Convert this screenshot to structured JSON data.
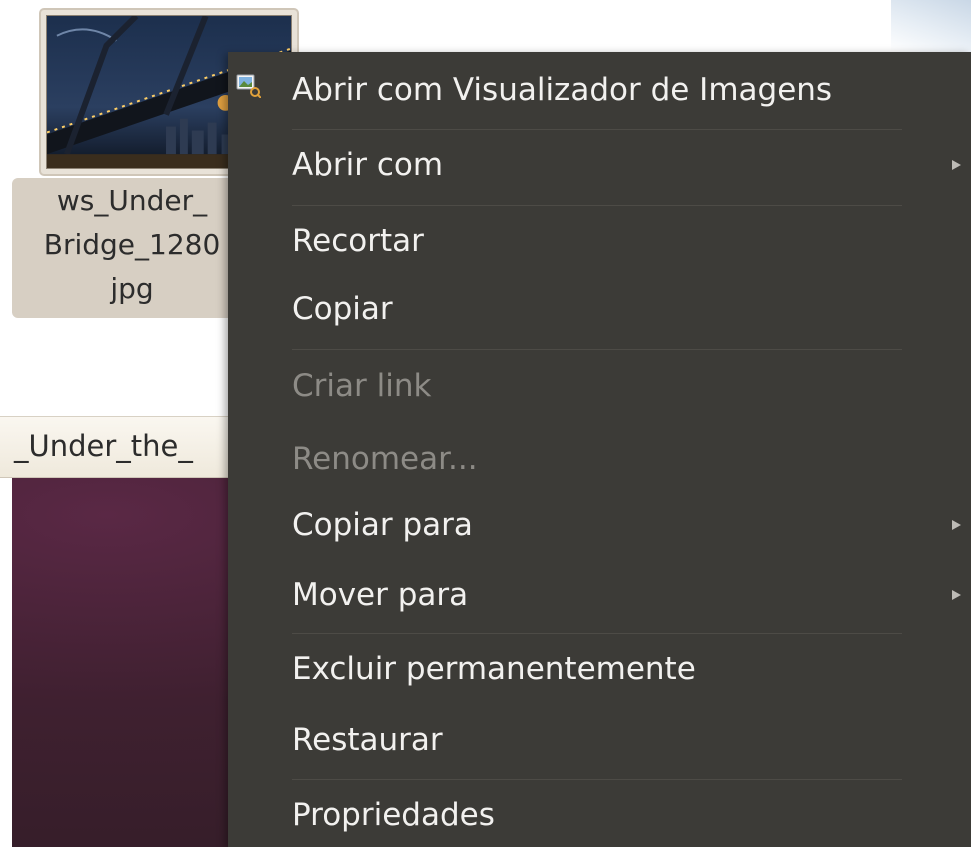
{
  "file": {
    "label_line1": "ws_Under_",
    "label_line2": "Bridge_1280",
    "label_line3": "jpg"
  },
  "path_bar": {
    "text": "_Under_the_"
  },
  "context_menu": {
    "items": [
      {
        "label": "Abrir com Visualizador de Imagens",
        "enabled": true,
        "icon": "image-viewer-icon",
        "submenu": false
      },
      {
        "label": "Abrir com",
        "enabled": true,
        "submenu": true
      },
      {
        "label": "Recortar",
        "enabled": true,
        "submenu": false
      },
      {
        "label": "Copiar",
        "enabled": true,
        "submenu": false
      },
      {
        "label": "Criar link",
        "enabled": false,
        "submenu": false
      },
      {
        "label": "Renomear...",
        "enabled": false,
        "submenu": false
      },
      {
        "label": "Copiar para",
        "enabled": true,
        "submenu": true
      },
      {
        "label": "Mover para",
        "enabled": true,
        "submenu": true
      },
      {
        "label": "Excluir permanentemente",
        "enabled": true,
        "submenu": false
      },
      {
        "label": "Restaurar",
        "enabled": true,
        "submenu": false
      },
      {
        "label": "Propriedades",
        "enabled": true,
        "submenu": false
      }
    ]
  },
  "colors": {
    "menu_background": "#3c3b37",
    "menu_text": "#f2f1ef",
    "menu_text_disabled": "#8d8b86",
    "desktop_background": "#3f2030",
    "file_label_background": "#d7cfc3"
  }
}
